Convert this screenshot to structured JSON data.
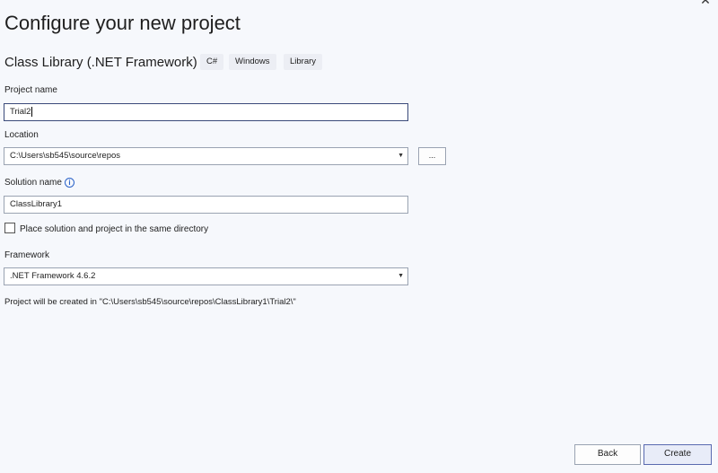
{
  "window": {
    "restore_icon": "restore-icon",
    "close_icon": "close-icon",
    "close_glyph": "✕"
  },
  "header": {
    "title": "Configure your new project",
    "template_name": "Class Library (.NET Framework)",
    "tags": [
      "C#",
      "Windows",
      "Library"
    ]
  },
  "form": {
    "project_name": {
      "label": "Project name",
      "value": "Trial2"
    },
    "location": {
      "label": "Location",
      "value": "C:\\Users\\sb545\\source\\repos",
      "browse_label": "..."
    },
    "solution_name": {
      "label": "Solution name",
      "value": "ClassLibrary1",
      "info_icon": "info-icon",
      "info_glyph": "i"
    },
    "same_directory": {
      "label": "Place solution and project in the same directory",
      "checked": false
    },
    "framework": {
      "label": "Framework",
      "value": ".NET Framework 4.6.2"
    },
    "path_info": "Project will be created in \"C:\\Users\\sb545\\source\\repos\\ClassLibrary1\\Trial2\\\""
  },
  "footer": {
    "back_label": "Back",
    "create_label": "Create"
  },
  "colors": {
    "background": "#f6f8fc",
    "accent": "#2b63c8"
  }
}
